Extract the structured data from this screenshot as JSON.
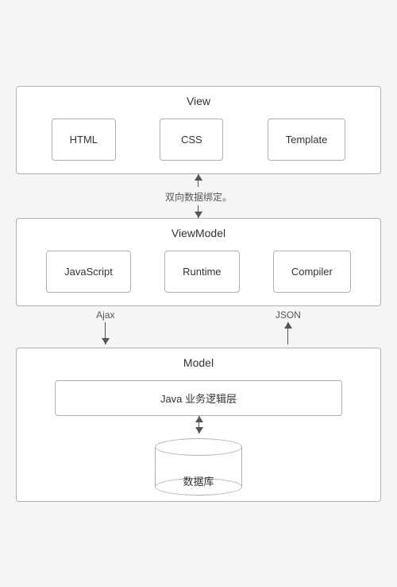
{
  "view": {
    "title": "View",
    "boxes": [
      "HTML",
      "CSS",
      "Template"
    ]
  },
  "connector1": {
    "label": "双向数据绑定。"
  },
  "viewmodel": {
    "title": "ViewModel",
    "boxes": [
      "JavaScript",
      "Runtime",
      "Compiler"
    ]
  },
  "connector2": {
    "left_label": "Ajax",
    "right_label": "JSON"
  },
  "model": {
    "title": "Model",
    "java_label": "Java 业务逻辑层",
    "db_label": "数据库"
  }
}
